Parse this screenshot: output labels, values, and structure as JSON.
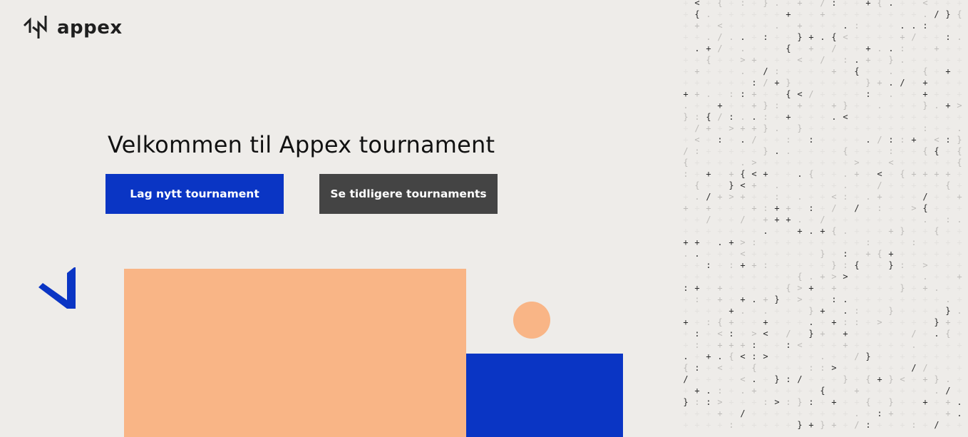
{
  "brand": {
    "name": "appex"
  },
  "hero": {
    "title": "Velkommen til Appex tournament"
  },
  "actions": {
    "create_label": "Lag nytt tournament",
    "history_label": "Se tidligere tournaments"
  },
  "colors": {
    "background": "#EEECE9",
    "primary": "#0A35C4",
    "secondary": "#444444",
    "accent_peach": "#F9B586",
    "text_dark": "#111111"
  },
  "icons": {
    "logo": "appex-logo-icon",
    "chevron": "chevron-decoration-icon",
    "code_pattern": "code-symbol-pattern"
  }
}
